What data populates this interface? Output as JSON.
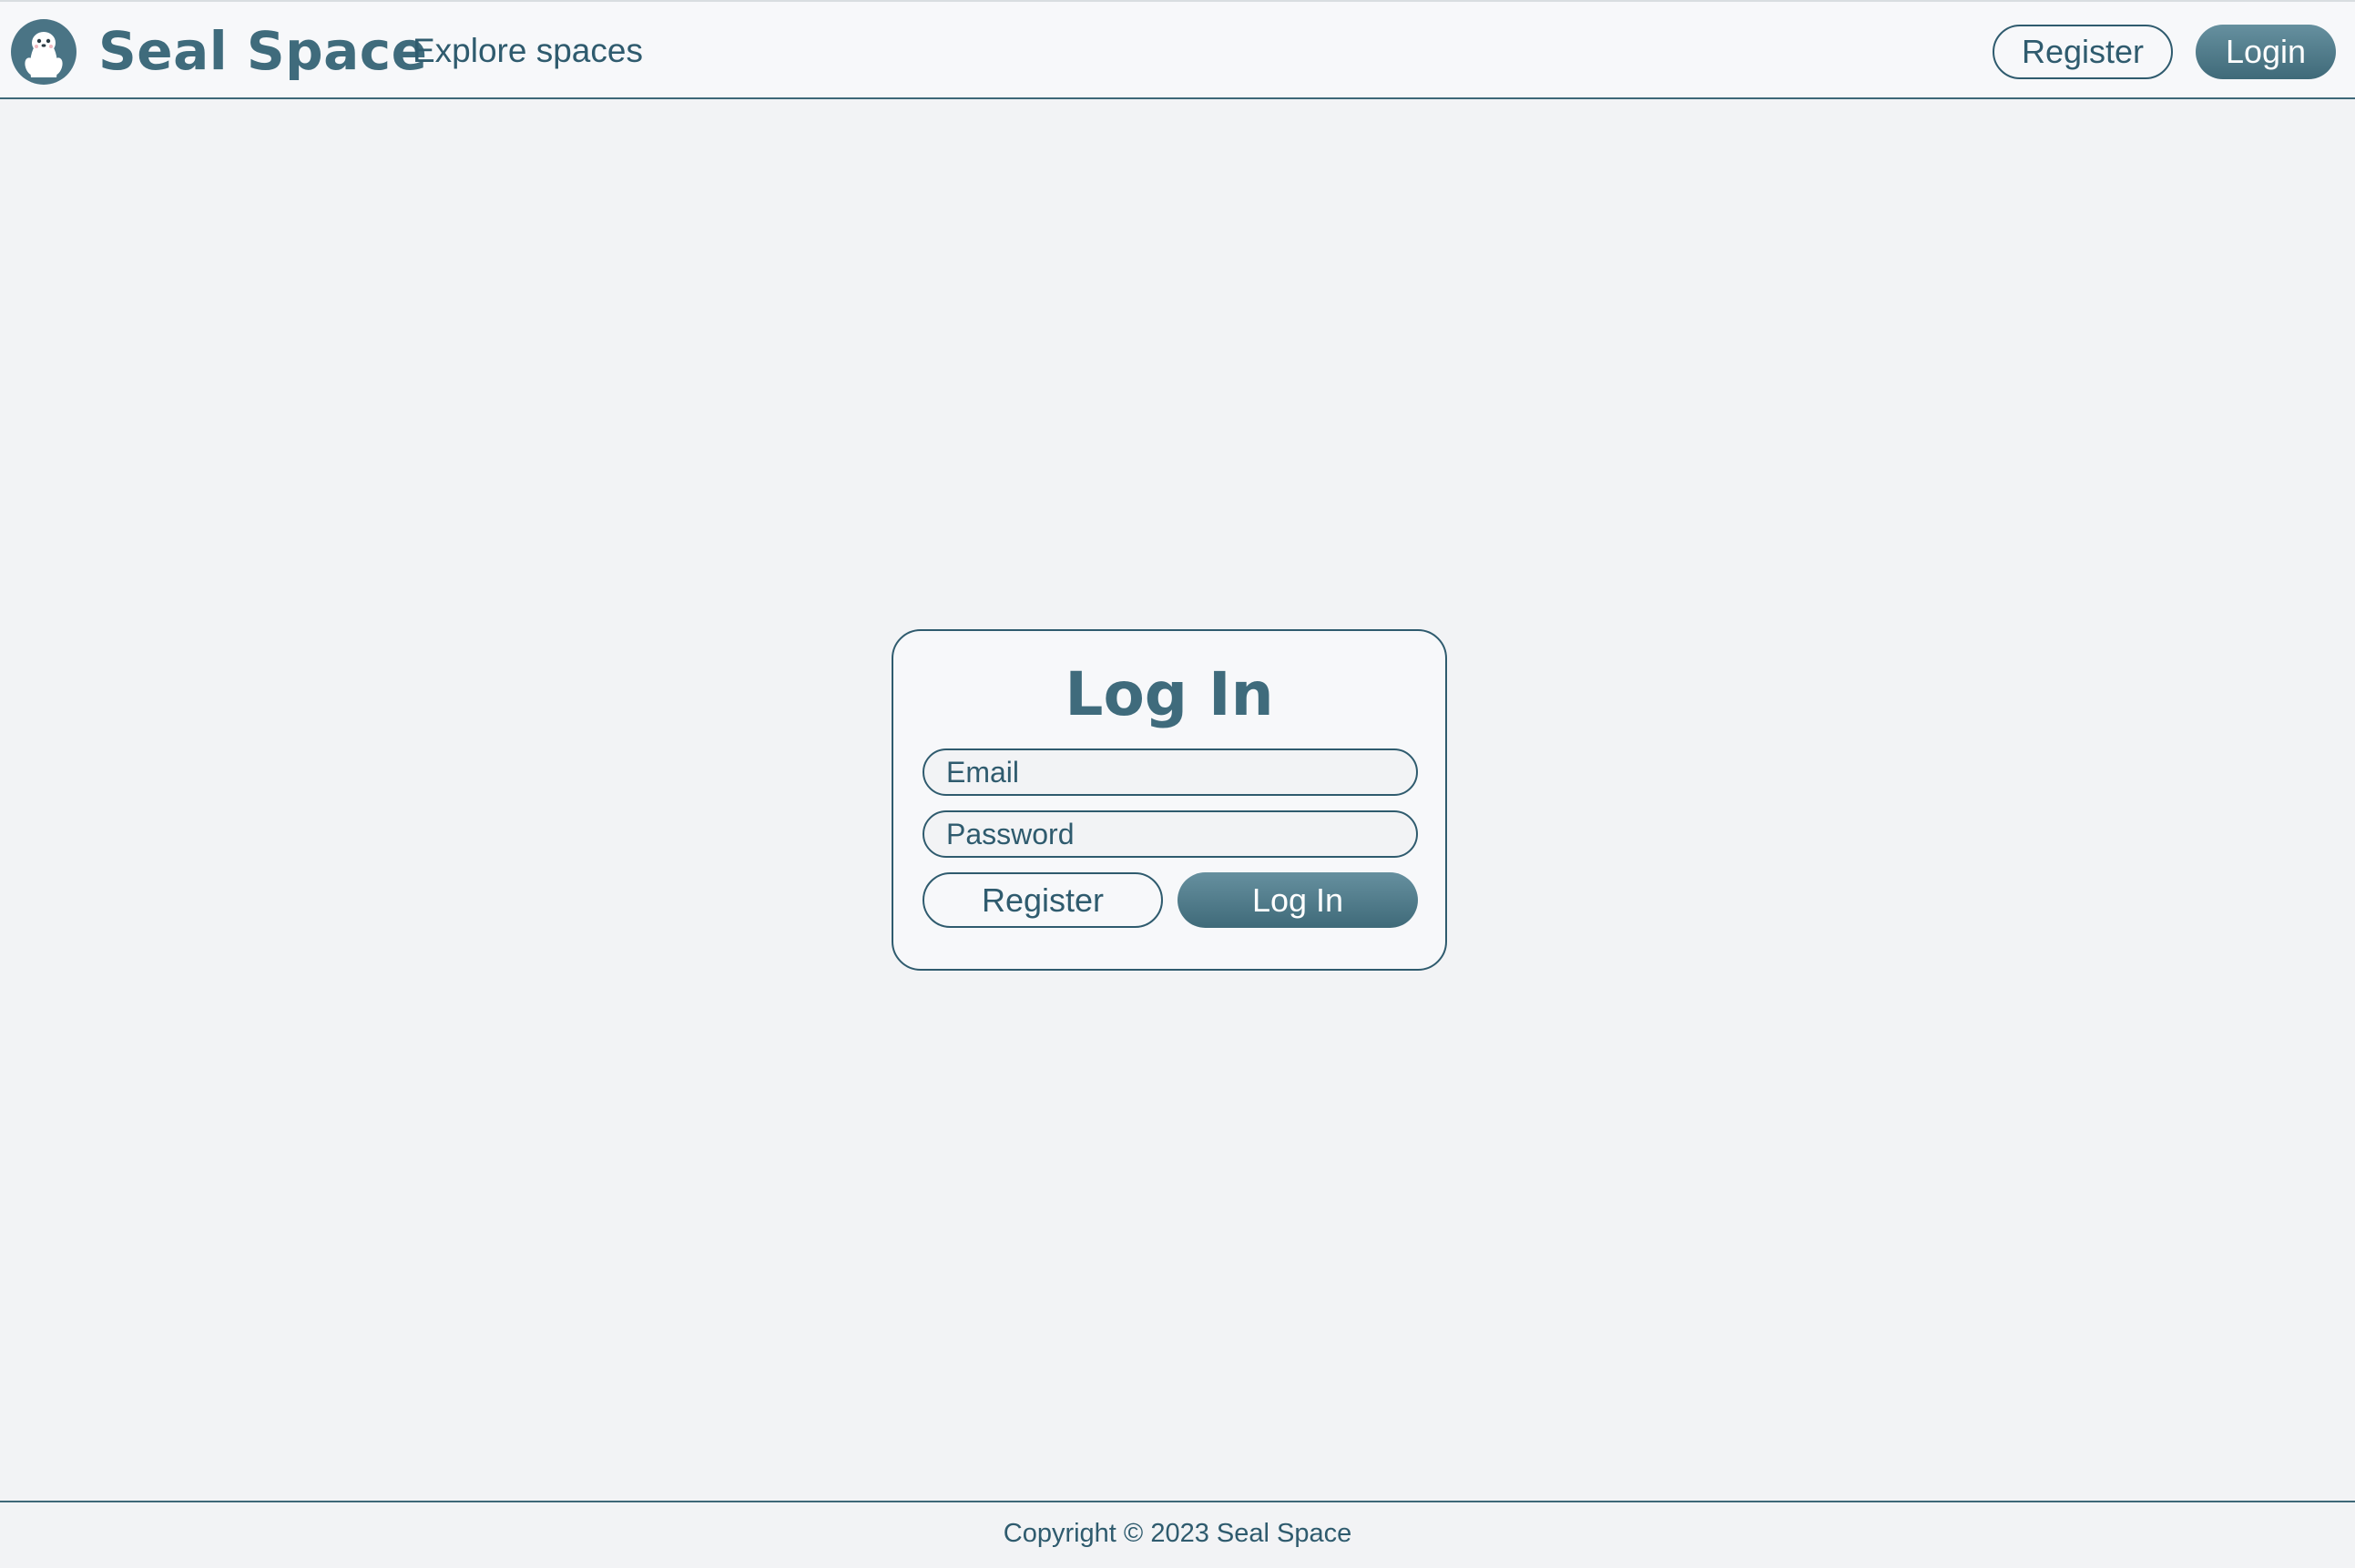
{
  "header": {
    "brand": "Seal Space",
    "explore_link": "Explore spaces",
    "register_label": "Register",
    "login_label": "Login"
  },
  "login_card": {
    "title": "Log In",
    "email_placeholder": "Email",
    "password_placeholder": "Password",
    "register_label": "Register",
    "login_label": "Log In"
  },
  "footer": {
    "copyright": "Copyright © 2023 Seal Space"
  },
  "icons": {
    "logo": "seal-logo-icon"
  },
  "colors": {
    "brand_primary": "#2f5b6e",
    "brand_accent": "#4a7485",
    "page_background": "#f2f3f5",
    "surface": "#f7f8fa"
  }
}
